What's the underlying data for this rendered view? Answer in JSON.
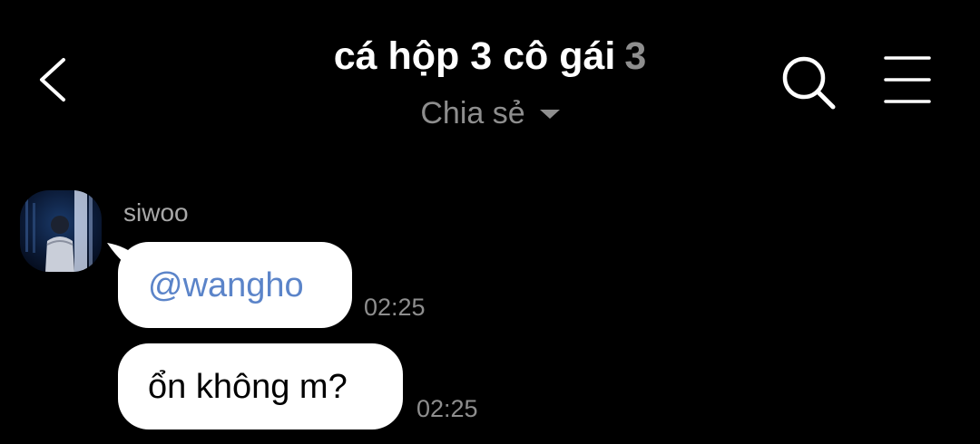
{
  "header": {
    "title": "cá hộp 3 cô gái",
    "member_count": "3",
    "share_label": "Chia sẻ"
  },
  "messages": [
    {
      "sender": "siwoo",
      "text": "@wangho",
      "type": "mention",
      "time": "02:25"
    },
    {
      "text": "ổn không m?",
      "time": "02:25"
    }
  ],
  "icons": {
    "back": "chevron-left-icon",
    "search": "search-icon",
    "menu": "hamburger-menu-icon",
    "share_dropdown": "caret-down-icon"
  },
  "colors": {
    "background": "#000000",
    "bubble": "#ffffff",
    "mention": "#5b84c9",
    "muted_text": "#8e8e8e"
  }
}
